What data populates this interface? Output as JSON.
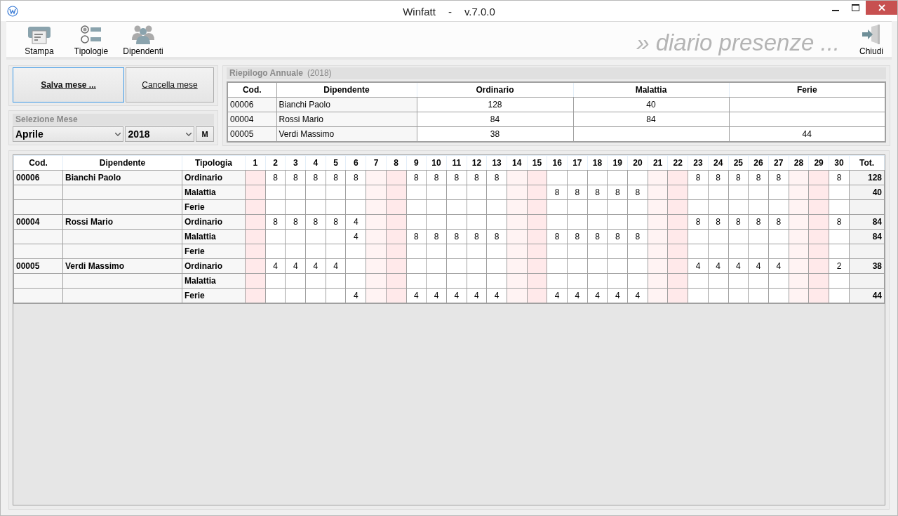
{
  "window": {
    "title": "Winfatt",
    "version": "v.7.0.0",
    "separator": "-"
  },
  "toolbar": {
    "items": [
      {
        "label": "Stampa",
        "kind": "print"
      },
      {
        "label": "Tipologie",
        "kind": "types"
      },
      {
        "label": "Dipendenti",
        "kind": "people"
      }
    ],
    "banner": "» diario presenze ...",
    "close": {
      "label": "Chiudi"
    }
  },
  "actions": {
    "save": {
      "label": "Salva mese ...",
      "focused": true
    },
    "cancel": {
      "label": "Cancella mese"
    }
  },
  "month_selection": {
    "title": "Selezione Mese",
    "month": "Aprile",
    "year": "2018",
    "button": "M"
  },
  "summary": {
    "title": "Riepilogo Annuale",
    "year": "(2018)",
    "columns": [
      "Cod.",
      "Dipendente",
      "Ordinario",
      "Malattia",
      "Ferie"
    ],
    "rows": [
      [
        "00006",
        "Bianchi Paolo",
        "128",
        "40",
        null
      ],
      [
        "00004",
        "Rossi Mario",
        "84",
        "84",
        null
      ],
      [
        "00005",
        "Verdi Massimo",
        "38",
        null,
        "44"
      ]
    ]
  },
  "grid": {
    "columns": [
      "Cod.",
      "Dipendente",
      "Tipologia"
    ],
    "total_label": "Tot.",
    "days": [
      {
        "label": "1",
        "kind": "sunday"
      },
      {
        "label": "2",
        "kind": "weekday"
      },
      {
        "label": "3",
        "kind": "weekday"
      },
      {
        "label": "4",
        "kind": "weekday"
      },
      {
        "label": "5",
        "kind": "weekday"
      },
      {
        "label": "6",
        "kind": "weekday"
      },
      {
        "label": "7",
        "kind": "saturday"
      },
      {
        "label": "8",
        "kind": "sunday"
      },
      {
        "label": "9",
        "kind": "weekday"
      },
      {
        "label": "10",
        "kind": "weekday"
      },
      {
        "label": "11",
        "kind": "weekday"
      },
      {
        "label": "12",
        "kind": "weekday"
      },
      {
        "label": "13",
        "kind": "weekday"
      },
      {
        "label": "14",
        "kind": "saturday"
      },
      {
        "label": "15",
        "kind": "sunday"
      },
      {
        "label": "16",
        "kind": "weekday"
      },
      {
        "label": "17",
        "kind": "weekday"
      },
      {
        "label": "18",
        "kind": "weekday"
      },
      {
        "label": "19",
        "kind": "weekday"
      },
      {
        "label": "20",
        "kind": "weekday"
      },
      {
        "label": "21",
        "kind": "saturday"
      },
      {
        "label": "22",
        "kind": "sunday"
      },
      {
        "label": "23",
        "kind": "weekday"
      },
      {
        "label": "24",
        "kind": "weekday"
      },
      {
        "label": "25",
        "kind": "weekday"
      },
      {
        "label": "26",
        "kind": "weekday"
      },
      {
        "label": "27",
        "kind": "weekday"
      },
      {
        "label": "28",
        "kind": "saturday"
      },
      {
        "label": "29",
        "kind": "sunday"
      },
      {
        "label": "30",
        "kind": "weekday"
      }
    ],
    "rows": [
      {
        "code": "00006",
        "name": "Bianchi Paolo",
        "type": "Ordinario",
        "cells": [
          null,
          "8",
          "8",
          "8",
          "8",
          "8",
          null,
          null,
          "8",
          "8",
          "8",
          "8",
          "8",
          null,
          null,
          null,
          null,
          null,
          null,
          null,
          null,
          null,
          "8",
          "8",
          "8",
          "8",
          "8",
          null,
          null,
          "8"
        ],
        "total": "128"
      },
      {
        "type": "Malattia",
        "cells": [
          null,
          null,
          null,
          null,
          null,
          null,
          null,
          null,
          null,
          null,
          null,
          null,
          null,
          null,
          null,
          "8",
          "8",
          "8",
          "8",
          "8",
          null,
          null,
          null,
          null,
          null,
          null,
          null,
          null,
          null,
          null
        ],
        "total": "40"
      },
      {
        "type": "Ferie",
        "cells": [
          null,
          null,
          null,
          null,
          null,
          null,
          null,
          null,
          null,
          null,
          null,
          null,
          null,
          null,
          null,
          null,
          null,
          null,
          null,
          null,
          null,
          null,
          null,
          null,
          null,
          null,
          null,
          null,
          null,
          null
        ],
        "total": null
      },
      {
        "code": "00004",
        "name": "Rossi Mario",
        "type": "Ordinario",
        "cells": [
          null,
          "8",
          "8",
          "8",
          "8",
          "4",
          null,
          null,
          null,
          null,
          null,
          null,
          null,
          null,
          null,
          null,
          null,
          null,
          null,
          null,
          null,
          null,
          "8",
          "8",
          "8",
          "8",
          "8",
          null,
          null,
          "8"
        ],
        "total": "84"
      },
      {
        "type": "Malattia",
        "cells": [
          null,
          null,
          null,
          null,
          null,
          "4",
          null,
          null,
          "8",
          "8",
          "8",
          "8",
          "8",
          null,
          null,
          "8",
          "8",
          "8",
          "8",
          "8",
          null,
          null,
          null,
          null,
          null,
          null,
          null,
          null,
          null,
          null
        ],
        "total": "84"
      },
      {
        "type": "Ferie",
        "cells": [
          null,
          null,
          null,
          null,
          null,
          null,
          null,
          null,
          null,
          null,
          null,
          null,
          null,
          null,
          null,
          null,
          null,
          null,
          null,
          null,
          null,
          null,
          null,
          null,
          null,
          null,
          null,
          null,
          null,
          null
        ],
        "total": null
      },
      {
        "code": "00005",
        "name": "Verdi Massimo",
        "type": "Ordinario",
        "cells": [
          null,
          "4",
          "4",
          "4",
          "4",
          null,
          null,
          null,
          null,
          null,
          null,
          null,
          null,
          null,
          null,
          null,
          null,
          null,
          null,
          null,
          null,
          null,
          "4",
          "4",
          "4",
          "4",
          "4",
          null,
          null,
          "2"
        ],
        "total": "38"
      },
      {
        "type": "Malattia",
        "cells": [
          null,
          null,
          null,
          null,
          null,
          null,
          null,
          null,
          null,
          null,
          null,
          null,
          null,
          null,
          null,
          null,
          null,
          null,
          null,
          null,
          null,
          null,
          null,
          null,
          null,
          null,
          null,
          null,
          null,
          null
        ],
        "total": null
      },
      {
        "type": "Ferie",
        "cells": [
          null,
          null,
          null,
          null,
          null,
          "4",
          null,
          null,
          "4",
          "4",
          "4",
          "4",
          "4",
          null,
          null,
          "4",
          "4",
          "4",
          "4",
          "4",
          null,
          null,
          null,
          null,
          null,
          null,
          null,
          null,
          null,
          null
        ],
        "total": "44"
      }
    ]
  }
}
